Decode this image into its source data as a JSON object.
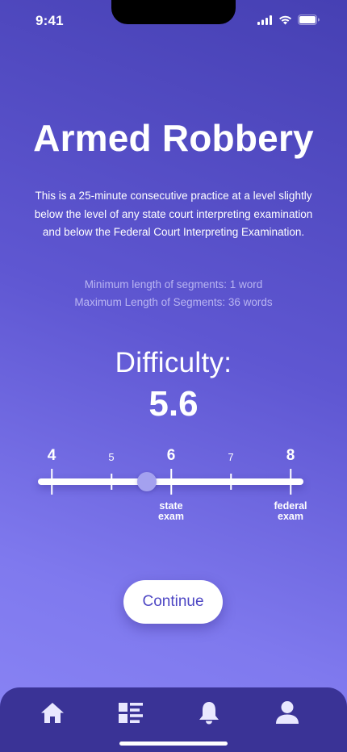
{
  "status": {
    "time": "9:41"
  },
  "practice": {
    "title": "Armed Robbery",
    "description": "This is a 25-minute consecutive practice at a level slightly below the level of any state court interpreting examination and below the Federal Court Interpreting Examination.",
    "min_segments": "Minimum length of segments: 1 word",
    "max_segments": "Maximum Length of Segments: 36 words"
  },
  "difficulty": {
    "label": "Difficulty:",
    "value_text": "5.6",
    "value": 5.6,
    "min": 4,
    "max": 8,
    "ticks": [
      {
        "label": "4",
        "value": 4,
        "major": true
      },
      {
        "label": "5",
        "value": 5,
        "major": false
      },
      {
        "label": "6",
        "value": 6,
        "major": true
      },
      {
        "label": "7",
        "value": 7,
        "major": false
      },
      {
        "label": "8",
        "value": 8,
        "major": true
      }
    ],
    "captions": [
      {
        "value": 6,
        "line1": "state",
        "line2": "exam"
      },
      {
        "value": 8,
        "line1": "federal",
        "line2": "exam"
      }
    ]
  },
  "actions": {
    "continue_label": "Continue"
  },
  "tabs": [
    {
      "name": "home",
      "icon": "home-icon"
    },
    {
      "name": "list",
      "icon": "list-icon"
    },
    {
      "name": "notifications",
      "icon": "bell-icon"
    },
    {
      "name": "profile",
      "icon": "user-icon"
    }
  ],
  "colors": {
    "accent": "#4e47c4",
    "thumb": "#a4a1ef",
    "tab_bar": "#3a3396",
    "tab_icon": "#e9e8ff"
  }
}
